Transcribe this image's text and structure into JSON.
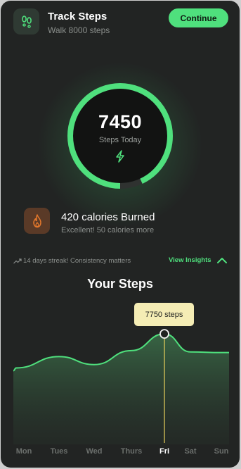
{
  "header": {
    "title": "Track Steps",
    "subtitle": "Walk 8000 steps",
    "continue_label": "Continue",
    "icon": "footprints-icon"
  },
  "progress": {
    "steps": "7450",
    "label": "Steps Today",
    "goal": 8000,
    "fraction": 0.93,
    "icon": "lightning-icon"
  },
  "calories": {
    "title": "420 calories Burned",
    "subtitle": "Excellent! 50 calories more",
    "icon": "fire-icon"
  },
  "streak": {
    "text": "14 days streak! Consistency matters",
    "insights_label": "View Insights"
  },
  "chart_data": {
    "type": "area",
    "title": "Your Steps",
    "categories": [
      "Mon",
      "Tues",
      "Wed",
      "Thurs",
      "Fri",
      "Sat",
      "Sun"
    ],
    "series": [
      {
        "values": [
          5200,
          6050,
          5450,
          6500,
          7750,
          6400,
          6350
        ]
      }
    ],
    "selected_index": 4,
    "tooltip": "7750 steps",
    "ylim": [
      0,
      9500
    ],
    "grid": false
  },
  "colors": {
    "accent": "#4fe07d",
    "background": "#222423",
    "ring_track": "#2f3230",
    "fire": "#e4782c",
    "tooltip": "#f5edb5"
  }
}
